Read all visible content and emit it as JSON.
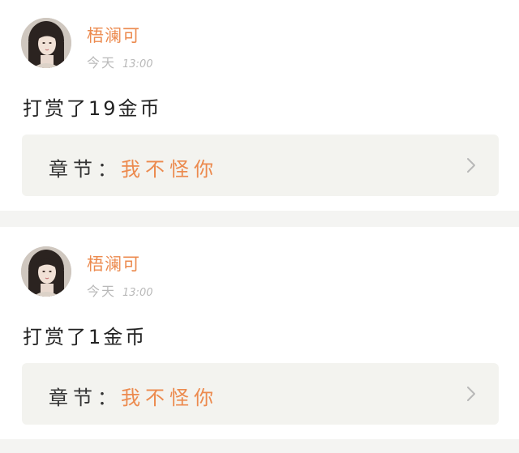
{
  "colors": {
    "accent": "#ec8a4e",
    "text": "#222222",
    "muted": "#b9b9b9",
    "panel": "#f3f3ef",
    "background": "#f4f4f2"
  },
  "rewards": [
    {
      "username": "梧澜可",
      "day": "今天",
      "time": "13:00",
      "message": "打赏了19金币",
      "chapter_label": "章节：",
      "chapter_title": "我不怪你",
      "avatar_icon": "user-avatar",
      "chevron_icon": "chevron-right-icon"
    },
    {
      "username": "梧澜可",
      "day": "今天",
      "time": "13:00",
      "message": "打赏了1金币",
      "chapter_label": "章节：",
      "chapter_title": "我不怪你",
      "avatar_icon": "user-avatar",
      "chevron_icon": "chevron-right-icon"
    }
  ]
}
